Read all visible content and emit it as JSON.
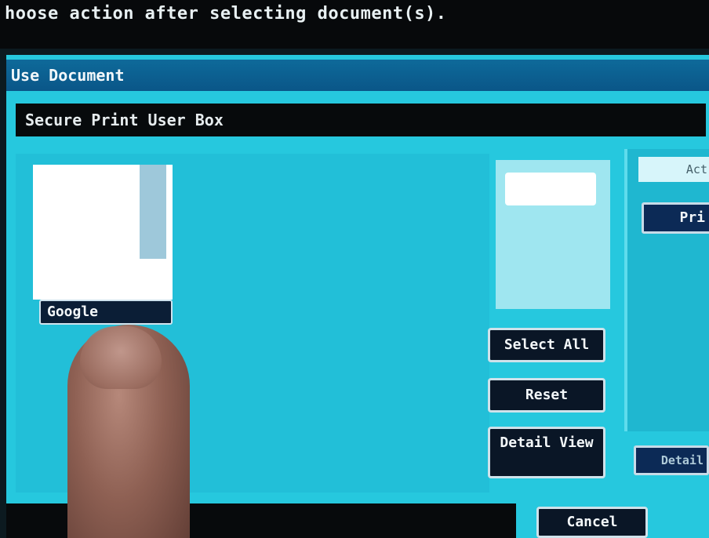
{
  "instruction": "hoose action after selecting document(s).",
  "window": {
    "title": "Use Document"
  },
  "box": {
    "name": "Secure Print User Box"
  },
  "documents": [
    {
      "name": "Google"
    }
  ],
  "buttons": {
    "select_all": "Select All",
    "reset": "Reset",
    "detail_view": "Detail View",
    "cancel": "Cancel"
  },
  "action_panel": {
    "header": "Act",
    "print": "Pri",
    "detail": "Detail"
  },
  "colors": {
    "panel_background": "#26c8de",
    "title_bar": "#0e6a9a",
    "box_name_bar": "#070a0c",
    "button_background": "#0a1626"
  }
}
